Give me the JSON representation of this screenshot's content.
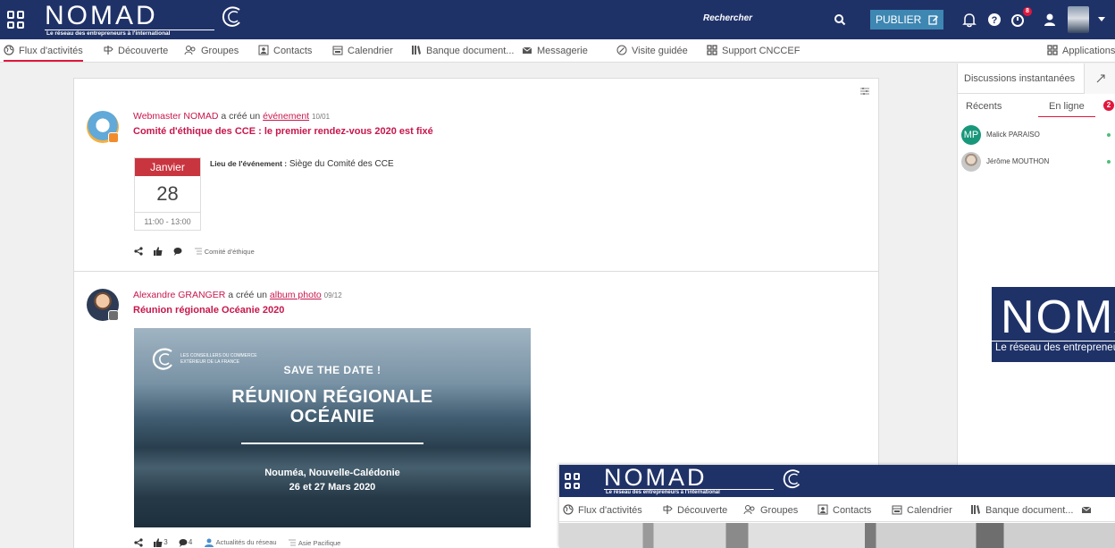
{
  "header": {
    "logo_word": "NOMAD",
    "logo_tagline": "Le réseau des entrepreneurs à l'international",
    "search_placeholder": "Rechercher",
    "publish_label": "PUBLIER",
    "notification_count": "8"
  },
  "nav": {
    "items": [
      {
        "label": "Flux d'activités",
        "icon": "globe-icon"
      },
      {
        "label": "Découverte",
        "icon": "signpost-icon"
      },
      {
        "label": "Groupes",
        "icon": "users-icon"
      },
      {
        "label": "Contacts",
        "icon": "contact-card-icon"
      },
      {
        "label": "Calendrier",
        "icon": "calendar-icon"
      },
      {
        "label": "Banque document...",
        "icon": "books-icon"
      },
      {
        "label": "Messagerie",
        "icon": "envelope-icon"
      },
      {
        "label": "Visite guidée",
        "icon": "compass-icon"
      },
      {
        "label": "Support CNCCEF",
        "icon": "grid-icon"
      }
    ],
    "applications_label": "Applications"
  },
  "posts": [
    {
      "author": "Webmaster NOMAD",
      "action": "a créé un",
      "object": "événement",
      "date": "10/01",
      "title": "Comité d'éthique des CCE : le premier rendez-vous 2020 est fixé",
      "event": {
        "month": "Janvier",
        "day": "28",
        "time": "11:00 - 13:00",
        "location_label": "Lieu de l'événement :",
        "location_value": "Siège du Comité des CCE"
      },
      "tag": "Comité d'éthique"
    },
    {
      "author": "Alexandre GRANGER",
      "action": "a créé un",
      "object": "album photo",
      "date": "09/12",
      "title": "Réunion régionale Océanie 2020",
      "image": {
        "org_line1": "LES CONSEILLERS DU COMMERCE",
        "org_line2": "EXTÉRIEUR DE LA FRANCE",
        "save_the_date": "SAVE THE DATE !",
        "title_line1": "RÉUNION RÉGIONALE",
        "title_line2": "OCÉANIE",
        "city": "Nouméa, Nouvelle-Calédonie",
        "dates": "26 et 27 Mars 2020"
      },
      "likes": "3",
      "comments": "4",
      "group": "Actualités du réseau",
      "tag": "Asie Pacifique"
    }
  ],
  "chat": {
    "title": "Discussions instantanées",
    "tab_recent": "Récents",
    "tab_online": "En ligne",
    "online_count": "2",
    "contacts": [
      {
        "initials": "MP",
        "name": "Malick PARAISO"
      },
      {
        "initials": "",
        "name": "Jérôme MOUTHON"
      }
    ],
    "logo_word": "NOMAD",
    "logo_tagline": "Le réseau des entrepreneurs à l'international"
  },
  "overlay_window": {
    "logo_word": "NOMAD",
    "logo_tagline": "Le réseau des entrepreneurs à l'international",
    "nav_items": [
      "Flux d'activités",
      "Découverte",
      "Groupes",
      "Contacts",
      "Calendrier",
      "Banque document..."
    ]
  }
}
